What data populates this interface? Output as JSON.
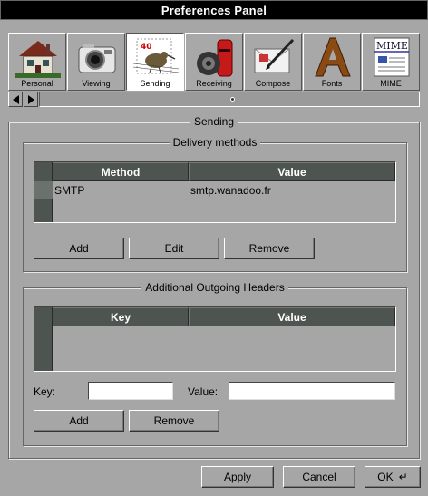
{
  "window": {
    "title": "Preferences Panel"
  },
  "toolbar": {
    "items": [
      {
        "label": "Personal",
        "icon": "house-icon",
        "active": false
      },
      {
        "label": "Viewing",
        "icon": "camera-icon",
        "active": false
      },
      {
        "label": "Sending",
        "icon": "stamp-icon",
        "active": true
      },
      {
        "label": "Receiving",
        "icon": "mailbox-icon",
        "active": false
      },
      {
        "label": "Compose",
        "icon": "letter-pen-icon",
        "active": false
      },
      {
        "label": "Fonts",
        "icon": "font-letter-icon",
        "active": false
      },
      {
        "label": "MIME",
        "icon": "mime-document-icon",
        "active": false
      }
    ],
    "mime_icon_text": "MIME",
    "stamp_value": "40"
  },
  "panel": {
    "title": "Sending"
  },
  "delivery": {
    "title": "Delivery methods",
    "columns": [
      "Method",
      "Value"
    ],
    "rows": [
      {
        "method": "SMTP",
        "value": "smtp.wanadoo.fr"
      }
    ],
    "buttons": {
      "add": "Add",
      "edit": "Edit",
      "remove": "Remove"
    }
  },
  "headers": {
    "title": "Additional Outgoing Headers",
    "columns": [
      "Key",
      "Value"
    ],
    "rows": [],
    "key_label": "Key:",
    "key_value": "",
    "value_label": "Value:",
    "value_value": "",
    "buttons": {
      "add": "Add",
      "remove": "Remove"
    }
  },
  "footer": {
    "apply": "Apply",
    "cancel": "Cancel",
    "ok": "OK"
  },
  "colors": {
    "background": "#a6a6a6",
    "table_header": "#4e5450",
    "titlebar": "#000000"
  }
}
